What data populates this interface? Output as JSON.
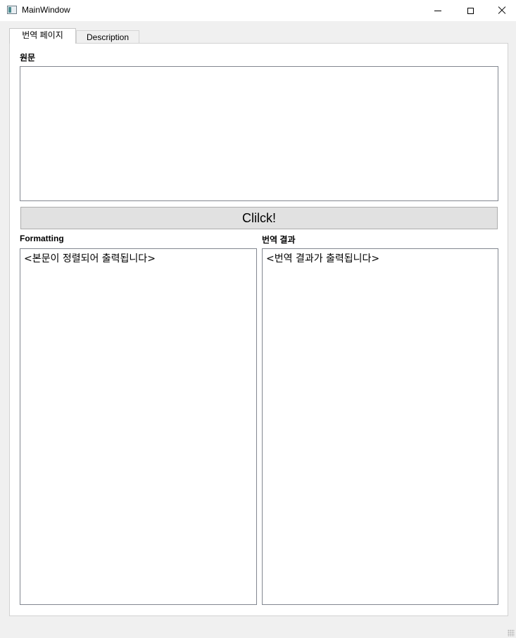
{
  "window": {
    "title": "MainWindow"
  },
  "tabs": [
    {
      "label": "번역 페이지",
      "active": true
    },
    {
      "label": "Description",
      "active": false
    }
  ],
  "source": {
    "label": "원문",
    "value": ""
  },
  "action": {
    "button_label": "Clilck!"
  },
  "formatting": {
    "label": "Formatting",
    "placeholder": "<본문이 정렬되어 출력됩니다>"
  },
  "result": {
    "label": "번역 결과",
    "placeholder": "<번역 결과가 출력됩니다>"
  }
}
